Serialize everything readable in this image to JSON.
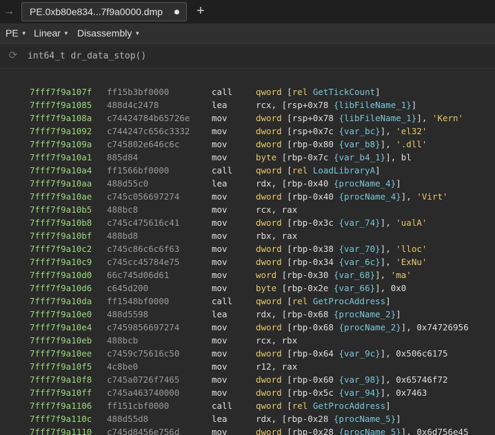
{
  "tab": {
    "back_glyph": "→",
    "title": "PE.0xb80e834...7f9a0000.dmp",
    "add_glyph": "+"
  },
  "toolbar": {
    "view_type": "PE",
    "layout": "Linear",
    "mode": "Disassembly"
  },
  "function": {
    "signature": "int64_t dr_data_stop()"
  },
  "colors": {
    "address": "#9bd87c",
    "bytes": "#9a9a9a",
    "keyword": "#e8c96a",
    "variable": "#79c7d8",
    "text": "#e0e0e0"
  },
  "instructions": [
    {
      "address": "7fff7f9a107f",
      "bytes": "ff15b3bf0000",
      "mnemonic": "call",
      "operands": [
        [
          "mem",
          "qword"
        ],
        [
          "p",
          " ["
        ],
        [
          "mem",
          "rel"
        ],
        [
          "p",
          " "
        ],
        [
          "sym",
          "GetTickCount"
        ],
        [
          "p",
          "]"
        ]
      ]
    },
    {
      "address": "7fff7f9a1085",
      "bytes": "488d4c2478",
      "mnemonic": "lea",
      "operands": [
        [
          "reg",
          "rcx"
        ],
        [
          "p",
          ", ["
        ],
        [
          "reg",
          "rsp"
        ],
        [
          "num",
          "+0x78"
        ],
        [
          "p",
          " "
        ],
        [
          "var",
          "{libFileName_1}"
        ],
        [
          "p",
          "]"
        ]
      ]
    },
    {
      "address": "7fff7f9a108a",
      "bytes": "c74424784b65726e",
      "mnemonic": "mov",
      "operands": [
        [
          "mem",
          "dword"
        ],
        [
          "p",
          " ["
        ],
        [
          "reg",
          "rsp"
        ],
        [
          "num",
          "+0x78"
        ],
        [
          "p",
          " "
        ],
        [
          "var",
          "{libFileName_1}"
        ],
        [
          "p",
          "], "
        ],
        [
          "str",
          "'Kern'"
        ]
      ]
    },
    {
      "address": "7fff7f9a1092",
      "bytes": "c744247c656c3332",
      "mnemonic": "mov",
      "operands": [
        [
          "mem",
          "dword"
        ],
        [
          "p",
          " ["
        ],
        [
          "reg",
          "rsp"
        ],
        [
          "num",
          "+0x7c"
        ],
        [
          "p",
          " "
        ],
        [
          "var",
          "{var_bc}"
        ],
        [
          "p",
          "], "
        ],
        [
          "str",
          "'el32'"
        ]
      ]
    },
    {
      "address": "7fff7f9a109a",
      "bytes": "c745802e646c6c",
      "mnemonic": "mov",
      "operands": [
        [
          "mem",
          "dword"
        ],
        [
          "p",
          " ["
        ],
        [
          "reg",
          "rbp"
        ],
        [
          "num",
          "-0x80"
        ],
        [
          "p",
          " "
        ],
        [
          "var",
          "{var_b8}"
        ],
        [
          "p",
          "], "
        ],
        [
          "str",
          "'.dll'"
        ]
      ]
    },
    {
      "address": "7fff7f9a10a1",
      "bytes": "885d84",
      "mnemonic": "mov",
      "operands": [
        [
          "mem",
          "byte"
        ],
        [
          "p",
          " ["
        ],
        [
          "reg",
          "rbp"
        ],
        [
          "num",
          "-0x7c"
        ],
        [
          "p",
          " "
        ],
        [
          "var",
          "{var_b4_1}"
        ],
        [
          "p",
          "], "
        ],
        [
          "reg",
          "bl"
        ]
      ]
    },
    {
      "address": "7fff7f9a10a4",
      "bytes": "ff1566bf0000",
      "mnemonic": "call",
      "operands": [
        [
          "mem",
          "qword"
        ],
        [
          "p",
          " ["
        ],
        [
          "mem",
          "rel"
        ],
        [
          "p",
          " "
        ],
        [
          "sym",
          "LoadLibraryA"
        ],
        [
          "p",
          "]"
        ]
      ]
    },
    {
      "address": "7fff7f9a10aa",
      "bytes": "488d55c0",
      "mnemonic": "lea",
      "operands": [
        [
          "reg",
          "rdx"
        ],
        [
          "p",
          ", ["
        ],
        [
          "reg",
          "rbp"
        ],
        [
          "num",
          "-0x40"
        ],
        [
          "p",
          " "
        ],
        [
          "var",
          "{procName_4}"
        ],
        [
          "p",
          "]"
        ]
      ]
    },
    {
      "address": "7fff7f9a10ae",
      "bytes": "c745c056697274",
      "mnemonic": "mov",
      "operands": [
        [
          "mem",
          "dword"
        ],
        [
          "p",
          " ["
        ],
        [
          "reg",
          "rbp"
        ],
        [
          "num",
          "-0x40"
        ],
        [
          "p",
          " "
        ],
        [
          "var",
          "{procName_4}"
        ],
        [
          "p",
          "], "
        ],
        [
          "str",
          "'Virt'"
        ]
      ]
    },
    {
      "address": "7fff7f9a10b5",
      "bytes": "488bc8",
      "mnemonic": "mov",
      "operands": [
        [
          "reg",
          "rcx"
        ],
        [
          "p",
          ", "
        ],
        [
          "reg",
          "rax"
        ]
      ]
    },
    {
      "address": "7fff7f9a10b8",
      "bytes": "c745c475616c41",
      "mnemonic": "mov",
      "operands": [
        [
          "mem",
          "dword"
        ],
        [
          "p",
          " ["
        ],
        [
          "reg",
          "rbp"
        ],
        [
          "num",
          "-0x3c"
        ],
        [
          "p",
          " "
        ],
        [
          "var",
          "{var_74}"
        ],
        [
          "p",
          "], "
        ],
        [
          "str",
          "'ualA'"
        ]
      ]
    },
    {
      "address": "7fff7f9a10bf",
      "bytes": "488bd8",
      "mnemonic": "mov",
      "operands": [
        [
          "reg",
          "rbx"
        ],
        [
          "p",
          ", "
        ],
        [
          "reg",
          "rax"
        ]
      ]
    },
    {
      "address": "7fff7f9a10c2",
      "bytes": "c745c86c6c6f63",
      "mnemonic": "mov",
      "operands": [
        [
          "mem",
          "dword"
        ],
        [
          "p",
          " ["
        ],
        [
          "reg",
          "rbp"
        ],
        [
          "num",
          "-0x38"
        ],
        [
          "p",
          " "
        ],
        [
          "var",
          "{var_70}"
        ],
        [
          "p",
          "], "
        ],
        [
          "str",
          "'lloc'"
        ]
      ]
    },
    {
      "address": "7fff7f9a10c9",
      "bytes": "c745cc45784e75",
      "mnemonic": "mov",
      "operands": [
        [
          "mem",
          "dword"
        ],
        [
          "p",
          " ["
        ],
        [
          "reg",
          "rbp"
        ],
        [
          "num",
          "-0x34"
        ],
        [
          "p",
          " "
        ],
        [
          "var",
          "{var_6c}"
        ],
        [
          "p",
          "], "
        ],
        [
          "str",
          "'ExNu'"
        ]
      ]
    },
    {
      "address": "7fff7f9a10d0",
      "bytes": "66c745d06d61",
      "mnemonic": "mov",
      "operands": [
        [
          "mem",
          "word"
        ],
        [
          "p",
          " ["
        ],
        [
          "reg",
          "rbp"
        ],
        [
          "num",
          "-0x30"
        ],
        [
          "p",
          " "
        ],
        [
          "var",
          "{var_68}"
        ],
        [
          "p",
          "], "
        ],
        [
          "str",
          "'ma'"
        ]
      ]
    },
    {
      "address": "7fff7f9a10d6",
      "bytes": "c645d200",
      "mnemonic": "mov",
      "operands": [
        [
          "mem",
          "byte"
        ],
        [
          "p",
          " ["
        ],
        [
          "reg",
          "rbp"
        ],
        [
          "num",
          "-0x2e"
        ],
        [
          "p",
          " "
        ],
        [
          "var",
          "{var_66}"
        ],
        [
          "p",
          "], "
        ],
        [
          "num",
          "0x0"
        ]
      ]
    },
    {
      "address": "7fff7f9a10da",
      "bytes": "ff1548bf0000",
      "mnemonic": "call",
      "operands": [
        [
          "mem",
          "qword"
        ],
        [
          "p",
          " ["
        ],
        [
          "mem",
          "rel"
        ],
        [
          "p",
          " "
        ],
        [
          "sym",
          "GetProcAddress"
        ],
        [
          "p",
          "]"
        ]
      ]
    },
    {
      "address": "7fff7f9a10e0",
      "bytes": "488d5598",
      "mnemonic": "lea",
      "operands": [
        [
          "reg",
          "rdx"
        ],
        [
          "p",
          ", ["
        ],
        [
          "reg",
          "rbp"
        ],
        [
          "num",
          "-0x68"
        ],
        [
          "p",
          " "
        ],
        [
          "var",
          "{procName_2}"
        ],
        [
          "p",
          "]"
        ]
      ]
    },
    {
      "address": "7fff7f9a10e4",
      "bytes": "c7459856697274",
      "mnemonic": "mov",
      "operands": [
        [
          "mem",
          "dword"
        ],
        [
          "p",
          " ["
        ],
        [
          "reg",
          "rbp"
        ],
        [
          "num",
          "-0x68"
        ],
        [
          "p",
          " "
        ],
        [
          "var",
          "{procName_2}"
        ],
        [
          "p",
          "], "
        ],
        [
          "num",
          "0x74726956"
        ]
      ]
    },
    {
      "address": "7fff7f9a10eb",
      "bytes": "488bcb",
      "mnemonic": "mov",
      "operands": [
        [
          "reg",
          "rcx"
        ],
        [
          "p",
          ", "
        ],
        [
          "reg",
          "rbx"
        ]
      ]
    },
    {
      "address": "7fff7f9a10ee",
      "bytes": "c7459c75616c50",
      "mnemonic": "mov",
      "operands": [
        [
          "mem",
          "dword"
        ],
        [
          "p",
          " ["
        ],
        [
          "reg",
          "rbp"
        ],
        [
          "num",
          "-0x64"
        ],
        [
          "p",
          " "
        ],
        [
          "var",
          "{var_9c}"
        ],
        [
          "p",
          "], "
        ],
        [
          "num",
          "0x506c6175"
        ]
      ]
    },
    {
      "address": "7fff7f9a10f5",
      "bytes": "4c8be0",
      "mnemonic": "mov",
      "operands": [
        [
          "reg",
          "r12"
        ],
        [
          "p",
          ", "
        ],
        [
          "reg",
          "rax"
        ]
      ]
    },
    {
      "address": "7fff7f9a10f8",
      "bytes": "c745a0726f7465",
      "mnemonic": "mov",
      "operands": [
        [
          "mem",
          "dword"
        ],
        [
          "p",
          " ["
        ],
        [
          "reg",
          "rbp"
        ],
        [
          "num",
          "-0x60"
        ],
        [
          "p",
          " "
        ],
        [
          "var",
          "{var_98}"
        ],
        [
          "p",
          "], "
        ],
        [
          "num",
          "0x65746f72"
        ]
      ]
    },
    {
      "address": "7fff7f9a10ff",
      "bytes": "c745a463740000",
      "mnemonic": "mov",
      "operands": [
        [
          "mem",
          "dword"
        ],
        [
          "p",
          " ["
        ],
        [
          "reg",
          "rbp"
        ],
        [
          "num",
          "-0x5c"
        ],
        [
          "p",
          " "
        ],
        [
          "var",
          "{var_94}"
        ],
        [
          "p",
          "], "
        ],
        [
          "num",
          "0x7463"
        ]
      ]
    },
    {
      "address": "7fff7f9a1106",
      "bytes": "ff151cbf0000",
      "mnemonic": "call",
      "operands": [
        [
          "mem",
          "qword"
        ],
        [
          "p",
          " ["
        ],
        [
          "mem",
          "rel"
        ],
        [
          "p",
          " "
        ],
        [
          "sym",
          "GetProcAddress"
        ],
        [
          "p",
          "]"
        ]
      ]
    },
    {
      "address": "7fff7f9a110c",
      "bytes": "488d55d8",
      "mnemonic": "lea",
      "operands": [
        [
          "reg",
          "rdx"
        ],
        [
          "p",
          ", ["
        ],
        [
          "reg",
          "rbp"
        ],
        [
          "num",
          "-0x28"
        ],
        [
          "p",
          " "
        ],
        [
          "var",
          "{procName_5}"
        ],
        [
          "p",
          "]"
        ]
      ]
    },
    {
      "address": "7fff7f9a1110",
      "bytes": "c745d8456e756d",
      "mnemonic": "mov",
      "operands": [
        [
          "mem",
          "dword"
        ],
        [
          "p",
          " ["
        ],
        [
          "reg",
          "rbp"
        ],
        [
          "num",
          "-0x28"
        ],
        [
          "p",
          " "
        ],
        [
          "var",
          "{procName_5}"
        ],
        [
          "p",
          "], "
        ],
        [
          "num",
          "0x6d756e45"
        ]
      ]
    }
  ]
}
